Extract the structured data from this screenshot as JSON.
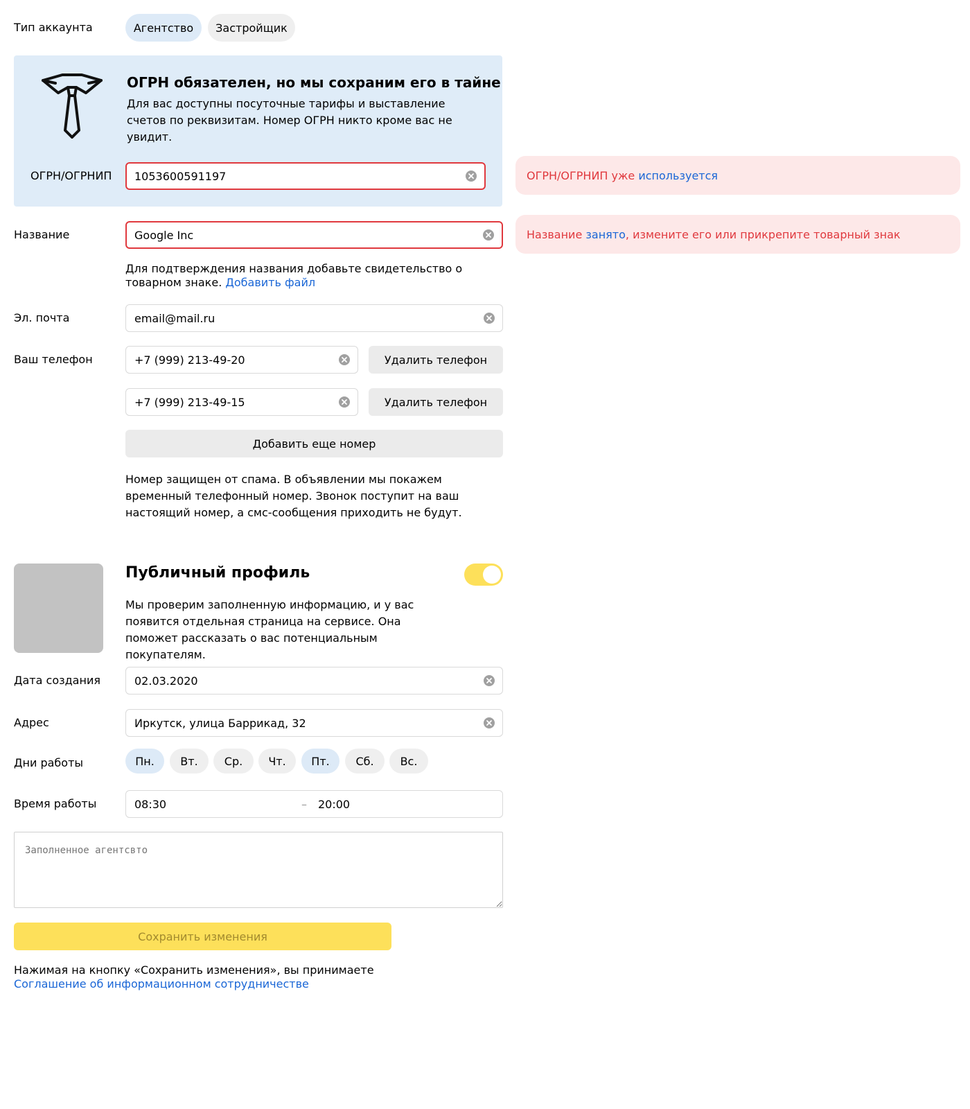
{
  "account_type": {
    "label": "Тип аккаунта",
    "options": [
      "Агентство",
      "Застройщик"
    ],
    "selected": "Агентство"
  },
  "ogrn_panel": {
    "icon": "tie-icon",
    "title": "ОГРН обязателен, но мы сохраним его в тайне",
    "description": "Для вас доступны посуточные тарифы и выставление счетов по реквизитам. Номер ОГРН никто кроме вас не увидит.",
    "field_label": "ОГРН/ОГРНИП",
    "field_value": "1053600591197"
  },
  "errors": {
    "ogrn": {
      "prefix": "ОГРН/ОГРНИП уже ",
      "link": "используется"
    },
    "name": {
      "prefix": "Название ",
      "link": "занято",
      "suffix": ", измените его или прикрепите товарный знак"
    }
  },
  "name_field": {
    "label": "Название",
    "value": "Google Inc",
    "hint": "Для подтверждения названия добавьте свидетельство о товарном знаке.",
    "hint_link": "Добавить файл"
  },
  "email_field": {
    "label": "Эл. почта",
    "value": "email@mail.ru"
  },
  "phones": {
    "label": "Ваш телефон",
    "items": [
      {
        "value": "+7 (999) 213-49-20",
        "remove_label": "Удалить телефон"
      },
      {
        "value": "+7 (999) 213-49-15",
        "remove_label": "Удалить телефон"
      }
    ],
    "add_label": "Добавить еще номер",
    "note": "Номер защищен от спама. В объявлении мы покажем временный телефонный номер. Звонок поступит на ваш настоящий номер, а смс-сообщения приходить не будут."
  },
  "public_profile": {
    "title": "Публичный профиль",
    "enabled": true,
    "description": "Мы проверим заполненную информацию, и у вас появится отдельная страница на сервисе. Она поможет рассказать о вас потенциальным покупателям."
  },
  "creation_date": {
    "label": "Дата создания",
    "value": "02.03.2020"
  },
  "address": {
    "label": "Адрес",
    "value": "Иркутск, улица Баррикад, 32"
  },
  "work_days": {
    "label": "Дни работы",
    "days": [
      "Пн.",
      "Вт.",
      "Ср.",
      "Чт.",
      "Пт.",
      "Сб.",
      "Вс."
    ],
    "selected": [
      "Пн.",
      "Пт."
    ]
  },
  "work_time": {
    "label": "Время работы",
    "from": "08:30",
    "separator": "–",
    "to": "20:00"
  },
  "about": {
    "placeholder": "Заполненное агентсвто"
  },
  "save": {
    "label": "Сохранить изменения"
  },
  "agreement": {
    "text": "Нажимая на кнопку «Сохранить изменения», вы принимаете",
    "link": "Соглашение об информационном сотрудничестве"
  },
  "colors": {
    "chip_active": "#ddeaf7",
    "panel_bg": "#dfecf8",
    "error": "#e0393e",
    "error_bg": "#fde8e8",
    "link": "#1a66d6",
    "accent_yellow": "#fde05a"
  }
}
